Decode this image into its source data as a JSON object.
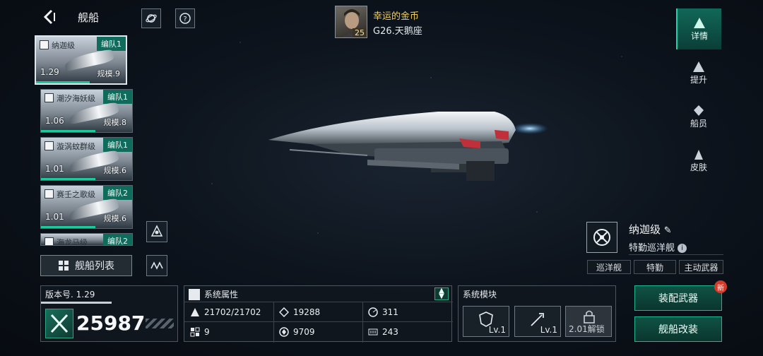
{
  "header": {
    "title": "舰船"
  },
  "commander": {
    "name": "幸运的金币",
    "server": "G26.天鹅座",
    "level": "25"
  },
  "ship_list": [
    {
      "name": "纳迦级",
      "fleet": "编队1",
      "version": "1.29",
      "scale": "规模.9",
      "selected": true
    },
    {
      "name": "潮汐海妖级",
      "fleet": "编队1",
      "version": "1.06",
      "scale": "规模.8",
      "selected": false
    },
    {
      "name": "漩涡蚊群级",
      "fleet": "编队1",
      "version": "1.01",
      "scale": "规模.6",
      "selected": false
    },
    {
      "name": "赛壬之歌级",
      "fleet": "编队2",
      "version": "1.01",
      "scale": "规模.6",
      "selected": false
    },
    {
      "name": "海龙马级",
      "fleet": "编队2",
      "version": "",
      "scale": "",
      "selected": false
    }
  ],
  "ship_list_button": "舰船列表",
  "tabs": [
    {
      "label": "详情",
      "active": true
    },
    {
      "label": "提升",
      "active": false
    },
    {
      "label": "船员",
      "active": false
    },
    {
      "label": "皮肤",
      "active": false
    }
  ],
  "ship": {
    "name": "纳迦级",
    "type": "特勤巡洋舰",
    "tags": [
      "巡洋舰",
      "特勤",
      "主动武器"
    ]
  },
  "version_panel": {
    "label": "版本号. 1.29",
    "power": "25987"
  },
  "attributes": {
    "title": "系统属性",
    "stats": [
      {
        "icon": "hull-icon",
        "value": "21702/21702"
      },
      {
        "icon": "armor-icon",
        "value": "19288"
      },
      {
        "icon": "speed-icon",
        "value": "311"
      },
      {
        "icon": "grid-icon",
        "value": "9"
      },
      {
        "icon": "shield-icon",
        "value": "9709"
      },
      {
        "icon": "energy-icon",
        "value": "243"
      }
    ]
  },
  "modules": {
    "title": "系统模块",
    "items": [
      {
        "level": "Lv.1"
      },
      {
        "level": "Lv.1"
      },
      {
        "level": "2.01解锁"
      }
    ]
  },
  "actions": {
    "equip": "装配武器",
    "refit": "舰船改装",
    "new_badge": "新"
  },
  "colors": {
    "accent": "#1fc79c",
    "gold": "#f2cf57"
  }
}
